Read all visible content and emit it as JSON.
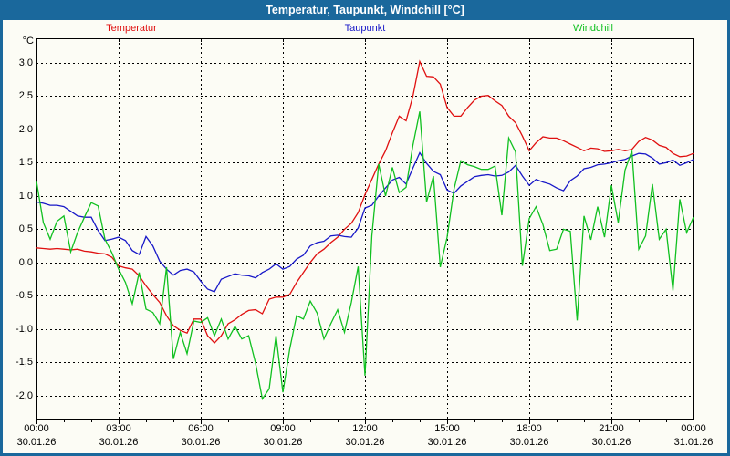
{
  "window": {
    "title": "Temperatur, Taupunkt, Windchill [°C]"
  },
  "chart_data": {
    "type": "line",
    "title": "Temperatur, Taupunkt, Windchill [°C]",
    "ylabel": "°C",
    "xlabel": "",
    "grid": "dashed",
    "legend_position": "top",
    "ylim": [
      -2.36,
      3.37
    ],
    "yticks": [
      {
        "value": 3.0,
        "label": "3,0"
      },
      {
        "value": 2.5,
        "label": "2,5"
      },
      {
        "value": 2.0,
        "label": "2,0"
      },
      {
        "value": 1.5,
        "label": "1,5"
      },
      {
        "value": 1.0,
        "label": "1,0"
      },
      {
        "value": 0.5,
        "label": "0,5"
      },
      {
        "value": 0.0,
        "label": "0,0"
      },
      {
        "value": -0.5,
        "label": "-0,5"
      },
      {
        "value": -1.0,
        "label": "-1,0"
      },
      {
        "value": -1.5,
        "label": "-1,5"
      },
      {
        "value": -2.0,
        "label": "-2,0"
      }
    ],
    "x_unit": "hours",
    "x_start": 0,
    "x_end": 24,
    "x_step": 0.25,
    "x_minor_tick_hours": 1,
    "xticks": [
      {
        "hour": 0,
        "time": "00:00",
        "date": "30.01.26"
      },
      {
        "hour": 3,
        "time": "03:00",
        "date": "30.01.26"
      },
      {
        "hour": 6,
        "time": "06:00",
        "date": "30.01.26"
      },
      {
        "hour": 9,
        "time": "09:00",
        "date": "30.01.26"
      },
      {
        "hour": 12,
        "time": "12:00",
        "date": "30.01.26"
      },
      {
        "hour": 15,
        "time": "15:00",
        "date": "30.01.26"
      },
      {
        "hour": 18,
        "time": "18:00",
        "date": "30.01.26"
      },
      {
        "hour": 21,
        "time": "21:00",
        "date": "30.01.26"
      },
      {
        "hour": 24,
        "time": "00:00",
        "date": "31.01.26"
      }
    ],
    "series": [
      {
        "name": "Temperatur",
        "color": "#e01010",
        "values": [
          0.22,
          0.21,
          0.2,
          0.21,
          0.2,
          0.19,
          0.2,
          0.17,
          0.16,
          0.14,
          0.13,
          0.08,
          -0.05,
          -0.08,
          -0.1,
          -0.2,
          -0.35,
          -0.48,
          -0.6,
          -0.8,
          -0.95,
          -1.02,
          -1.06,
          -0.85,
          -0.85,
          -1.1,
          -1.21,
          -1.1,
          -0.92,
          -0.86,
          -0.78,
          -0.72,
          -0.71,
          -0.77,
          -0.55,
          -0.52,
          -0.52,
          -0.48,
          -0.3,
          -0.15,
          0.0,
          0.13,
          0.2,
          0.3,
          0.38,
          0.5,
          0.59,
          0.75,
          1.02,
          1.25,
          1.48,
          1.68,
          1.95,
          2.2,
          2.13,
          2.5,
          3.02,
          2.8,
          2.79,
          2.68,
          2.33,
          2.2,
          2.2,
          2.33,
          2.44,
          2.5,
          2.51,
          2.43,
          2.36,
          2.2,
          2.1,
          1.9,
          1.68,
          1.8,
          1.89,
          1.87,
          1.87,
          1.83,
          1.78,
          1.73,
          1.68,
          1.72,
          1.71,
          1.67,
          1.68,
          1.7,
          1.68,
          1.7,
          1.82,
          1.88,
          1.84,
          1.76,
          1.73,
          1.64,
          1.59,
          1.6,
          1.64
        ]
      },
      {
        "name": "Taupunkt",
        "color": "#1818c8",
        "values": [
          0.91,
          0.89,
          0.86,
          0.86,
          0.84,
          0.77,
          0.7,
          0.68,
          0.68,
          0.48,
          0.33,
          0.35,
          0.38,
          0.33,
          0.18,
          0.12,
          0.39,
          0.25,
          0.02,
          -0.1,
          -0.19,
          -0.12,
          -0.1,
          -0.14,
          -0.28,
          -0.4,
          -0.44,
          -0.25,
          -0.21,
          -0.17,
          -0.19,
          -0.2,
          -0.23,
          -0.15,
          -0.1,
          -0.02,
          -0.1,
          -0.06,
          0.05,
          0.11,
          0.25,
          0.3,
          0.32,
          0.4,
          0.41,
          0.39,
          0.38,
          0.52,
          0.82,
          0.86,
          1.0,
          1.12,
          1.24,
          1.28,
          1.18,
          1.42,
          1.65,
          1.49,
          1.37,
          1.32,
          1.09,
          1.04,
          1.15,
          1.22,
          1.29,
          1.31,
          1.32,
          1.3,
          1.31,
          1.36,
          1.46,
          1.3,
          1.16,
          1.25,
          1.21,
          1.18,
          1.12,
          1.08,
          1.23,
          1.3,
          1.41,
          1.43,
          1.47,
          1.48,
          1.5,
          1.53,
          1.55,
          1.6,
          1.64,
          1.63,
          1.57,
          1.48,
          1.5,
          1.54,
          1.46,
          1.5,
          1.55
        ]
      },
      {
        "name": "Windchill",
        "color": "#10c020",
        "values": [
          1.22,
          0.6,
          0.35,
          0.62,
          0.7,
          0.16,
          0.45,
          0.68,
          0.9,
          0.85,
          0.35,
          0.15,
          -0.1,
          -0.3,
          -0.62,
          -0.15,
          -0.7,
          -0.75,
          -0.92,
          -0.07,
          -1.45,
          -1.05,
          -1.37,
          -0.88,
          -0.9,
          -0.83,
          -1.1,
          -0.85,
          -1.15,
          -0.96,
          -1.15,
          -1.1,
          -1.51,
          -2.05,
          -1.9,
          -1.1,
          -1.95,
          -1.3,
          -0.8,
          -0.85,
          -0.58,
          -0.76,
          -1.15,
          -0.92,
          -0.71,
          -1.05,
          -0.6,
          -0.06,
          -1.7,
          0.4,
          1.48,
          1.0,
          1.43,
          1.05,
          1.13,
          1.76,
          2.27,
          0.91,
          1.3,
          -0.07,
          0.38,
          1.1,
          1.53,
          1.47,
          1.44,
          1.4,
          1.4,
          1.45,
          0.71,
          1.87,
          1.66,
          -0.05,
          0.66,
          0.84,
          0.57,
          0.18,
          0.2,
          0.5,
          0.47,
          -0.87,
          0.7,
          0.34,
          0.84,
          0.38,
          1.16,
          0.6,
          1.39,
          1.68,
          0.2,
          0.4,
          1.18,
          0.35,
          0.5,
          -0.42,
          0.95,
          0.45,
          0.68
        ]
      }
    ]
  }
}
